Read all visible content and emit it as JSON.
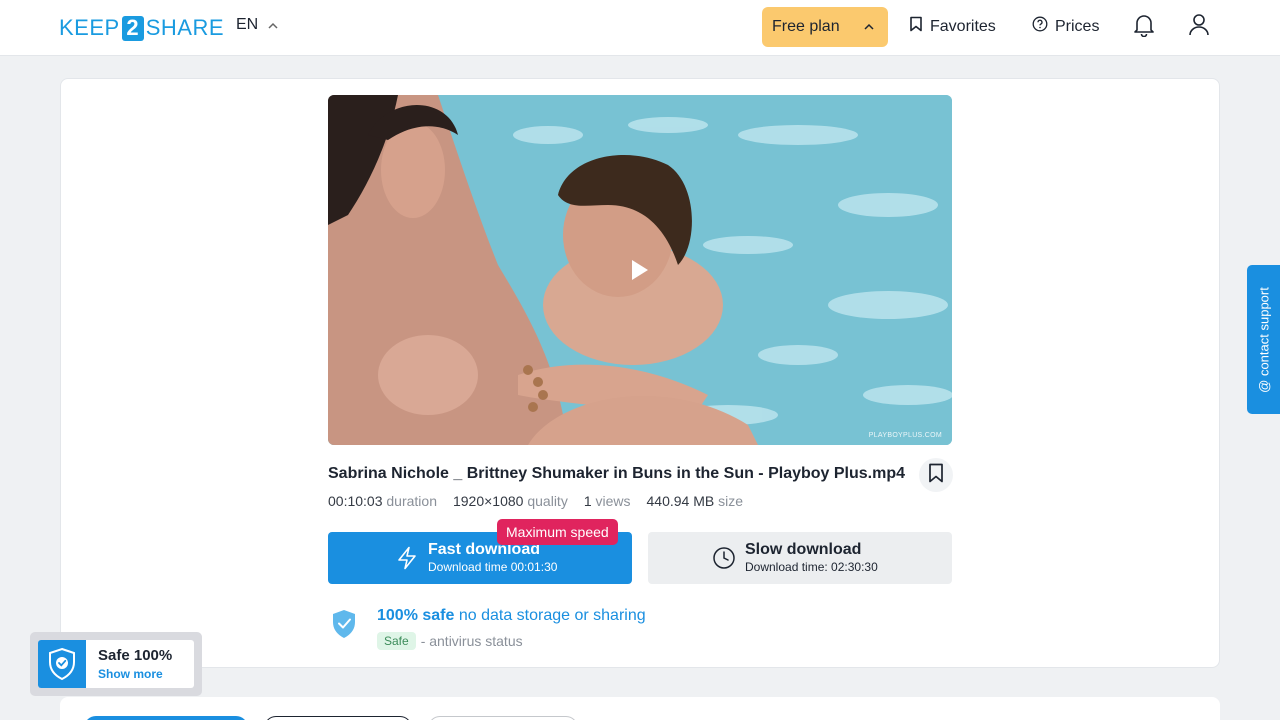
{
  "header": {
    "logo_left": "KEEP",
    "logo_num": "2",
    "logo_right": "SHARE",
    "language": "EN",
    "plan_label": "Free plan",
    "favorites_label": "Favorites",
    "prices_label": "Prices"
  },
  "file": {
    "watermark": "PLAYBOYPLUS.COM",
    "title": "Sabrina Nichole _ Brittney Shumaker in Buns in the Sun - Playboy Plus.mp4",
    "duration_value": "00:10:03",
    "duration_label": "duration",
    "quality_value": "1920×1080",
    "quality_label": "quality",
    "views_value": "1",
    "views_label": "views",
    "size_value": "440.94 MB",
    "size_label": "size"
  },
  "download": {
    "max_speed_badge": "Maximum speed",
    "fast_label": "Fast download",
    "fast_time": "Download time 00:01:30",
    "slow_label": "Slow download",
    "slow_time": "Download time: 02:30:30"
  },
  "security": {
    "safe_bold": "100% safe",
    "safe_text": "no data storage or sharing",
    "status_badge": "Safe",
    "status_text": "- antivirus status"
  },
  "float_badge": {
    "title": "Safe 100%",
    "link": "Show more"
  },
  "support": {
    "label": "@ contact support"
  },
  "colors": {
    "brand_blue": "#1a8fe0",
    "plan_yellow": "#fbc96e",
    "max_speed_red": "#e0245e"
  }
}
